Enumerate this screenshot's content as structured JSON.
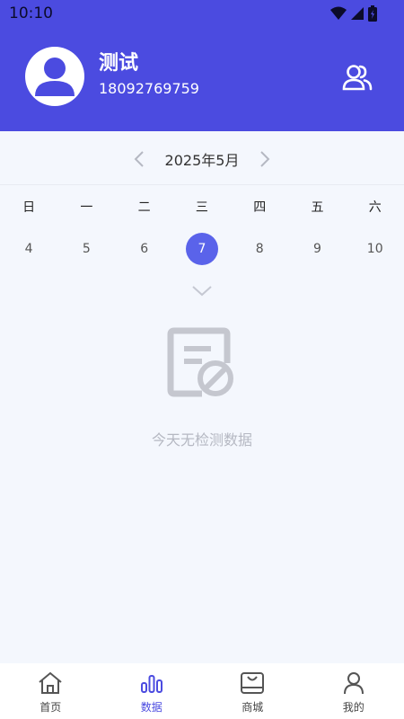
{
  "status_bar": {
    "time": "10:10"
  },
  "profile": {
    "name": "测试",
    "phone": "18092769759"
  },
  "calendar": {
    "month_label": "2025年5月",
    "weekdays": [
      "日",
      "一",
      "二",
      "三",
      "四",
      "五",
      "六"
    ],
    "dates": [
      "4",
      "5",
      "6",
      "7",
      "8",
      "9",
      "10"
    ],
    "selected_index": 3
  },
  "empty_state": {
    "message": "今天无检测数据"
  },
  "tabbar": {
    "items": [
      {
        "label": "首页",
        "icon": "home-icon"
      },
      {
        "label": "数据",
        "icon": "bar-chart-icon"
      },
      {
        "label": "商城",
        "icon": "shop-icon"
      },
      {
        "label": "我的",
        "icon": "user-icon"
      }
    ],
    "active_index": 1
  },
  "colors": {
    "header": "#4b4be0",
    "accent": "#5a63ea",
    "background": "#f4f7fd"
  }
}
